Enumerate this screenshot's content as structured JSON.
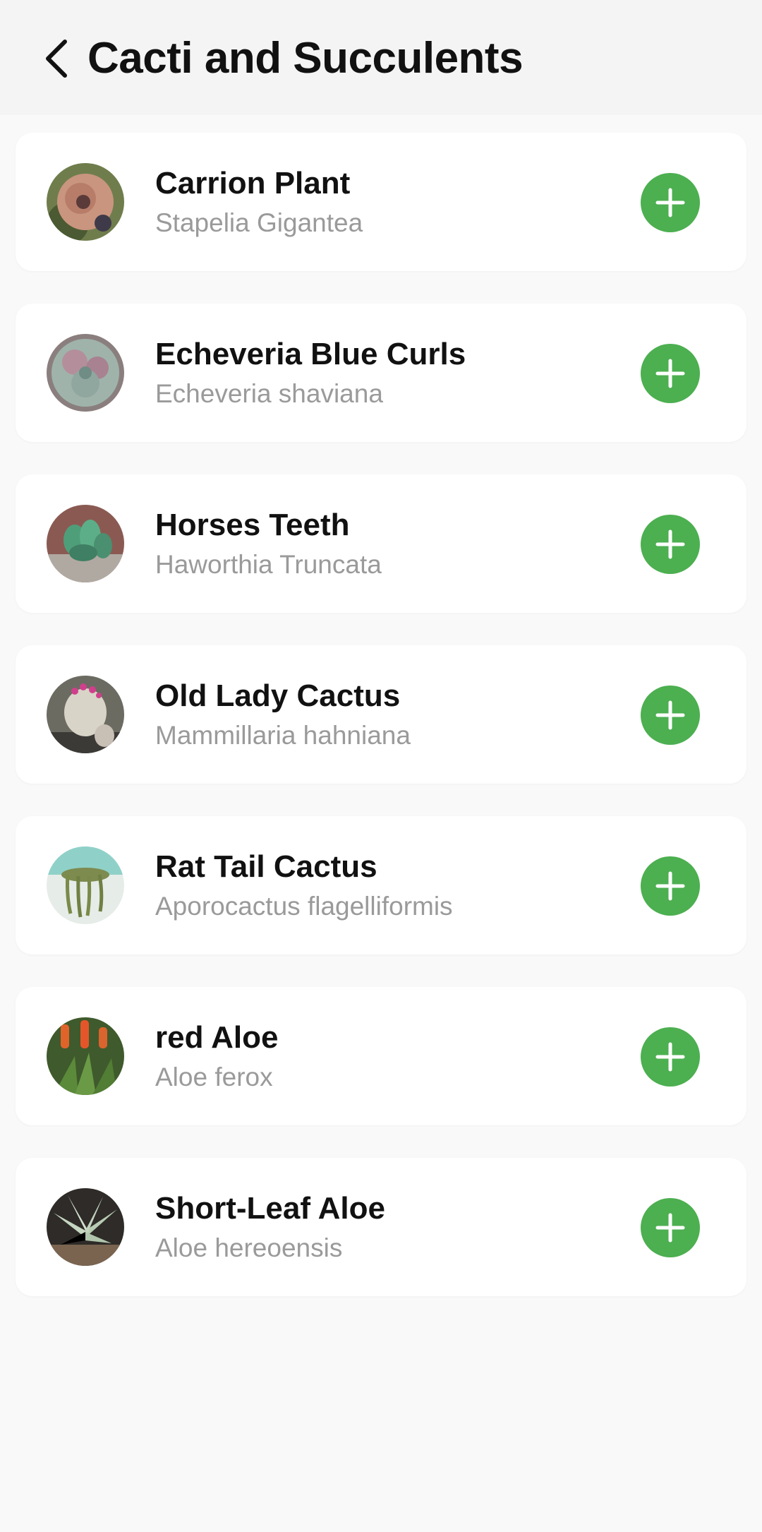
{
  "header": {
    "title": "Cacti and Succulents",
    "back_icon": "chevron-left-icon"
  },
  "colors": {
    "accent": "#4caf50",
    "background": "#f9f9f9",
    "card": "#ffffff",
    "secondary_text": "#9a9a9a"
  },
  "plants": [
    {
      "name": "Carrion Plant",
      "scientific": "Stapelia Gigantea",
      "thumb_icon": "stapelia-photo",
      "action_icon": "plus-icon"
    },
    {
      "name": "Echeveria Blue Curls",
      "scientific": "Echeveria shaviana",
      "thumb_icon": "echeveria-photo",
      "action_icon": "plus-icon"
    },
    {
      "name": "Horses Teeth",
      "scientific": "Haworthia Truncata",
      "thumb_icon": "haworthia-photo",
      "action_icon": "plus-icon"
    },
    {
      "name": "Old Lady Cactus",
      "scientific": "Mammillaria hahniana",
      "thumb_icon": "mammillaria-photo",
      "action_icon": "plus-icon"
    },
    {
      "name": "Rat Tail Cactus",
      "scientific": "Aporocactus flagelliformis",
      "thumb_icon": "aporocactus-photo",
      "action_icon": "plus-icon"
    },
    {
      "name": "red Aloe",
      "scientific": "Aloe ferox",
      "thumb_icon": "aloe-ferox-photo",
      "action_icon": "plus-icon"
    },
    {
      "name": "Short-Leaf Aloe",
      "scientific": "Aloe hereoensis",
      "thumb_icon": "aloe-hereoensis-photo",
      "action_icon": "plus-icon"
    }
  ]
}
